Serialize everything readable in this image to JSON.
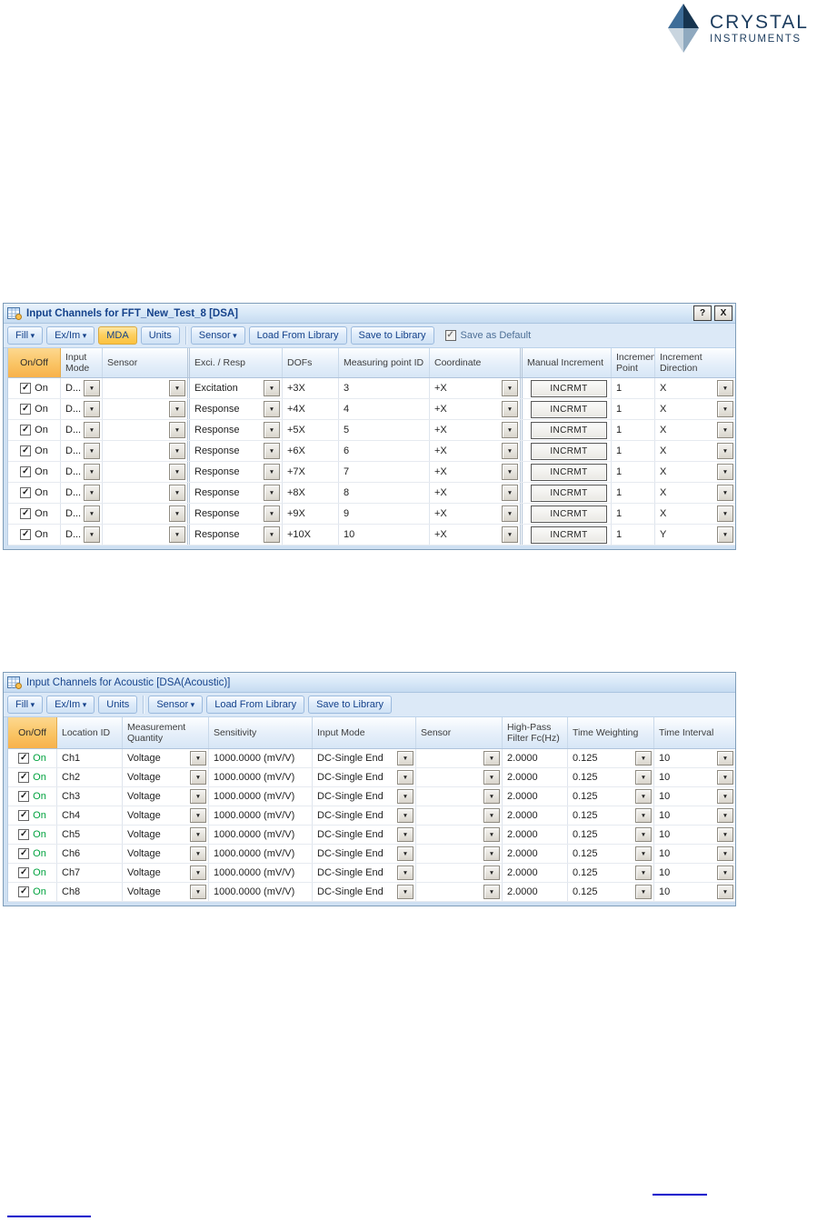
{
  "logo": {
    "line1": "CRYSTAL",
    "line2": "INSTRUMENTS"
  },
  "colors": {
    "accent_orange": "#FBBC50",
    "office_blue": "#15428B",
    "on_green": "#00A23E",
    "link_blue": "#0000CC",
    "logo_navy": "#1C3C5E"
  },
  "dialog1": {
    "title": "Input Channels for FFT_New_Test_8 [DSA]",
    "help_label": "?",
    "close_label": "X",
    "toolbar": {
      "fill": "Fill",
      "exim": "Ex/Im",
      "mda": "MDA",
      "units": "Units",
      "sensor": "Sensor",
      "load": "Load From Library",
      "save": "Save to Library",
      "save_default": "Save as Default",
      "save_default_checked": true
    },
    "columns": [
      "On/Off",
      "Input Mode",
      "Sensor",
      "Exci. / Resp",
      "DOFs",
      "Measuring point ID",
      "Coordinate",
      "Manual Increment",
      "Increment Point",
      "Increment Direction"
    ],
    "rows": [
      {
        "on": "On",
        "input_mode": "D...",
        "sensor": "",
        "exci_resp": "Excitation",
        "dofs": "+3X",
        "point_id": "3",
        "coordinate": "+X",
        "increment": "INCRMT",
        "inc_point": "1",
        "inc_dir": "X"
      },
      {
        "on": "On",
        "input_mode": "D...",
        "sensor": "",
        "exci_resp": "Response",
        "dofs": "+4X",
        "point_id": "4",
        "coordinate": "+X",
        "increment": "INCRMT",
        "inc_point": "1",
        "inc_dir": "X"
      },
      {
        "on": "On",
        "input_mode": "D...",
        "sensor": "",
        "exci_resp": "Response",
        "dofs": "+5X",
        "point_id": "5",
        "coordinate": "+X",
        "increment": "INCRMT",
        "inc_point": "1",
        "inc_dir": "X"
      },
      {
        "on": "On",
        "input_mode": "D...",
        "sensor": "",
        "exci_resp": "Response",
        "dofs": "+6X",
        "point_id": "6",
        "coordinate": "+X",
        "increment": "INCRMT",
        "inc_point": "1",
        "inc_dir": "X"
      },
      {
        "on": "On",
        "input_mode": "D...",
        "sensor": "",
        "exci_resp": "Response",
        "dofs": "+7X",
        "point_id": "7",
        "coordinate": "+X",
        "increment": "INCRMT",
        "inc_point": "1",
        "inc_dir": "X"
      },
      {
        "on": "On",
        "input_mode": "D...",
        "sensor": "",
        "exci_resp": "Response",
        "dofs": "+8X",
        "point_id": "8",
        "coordinate": "+X",
        "increment": "INCRMT",
        "inc_point": "1",
        "inc_dir": "X"
      },
      {
        "on": "On",
        "input_mode": "D...",
        "sensor": "",
        "exci_resp": "Response",
        "dofs": "+9X",
        "point_id": "9",
        "coordinate": "+X",
        "increment": "INCRMT",
        "inc_point": "1",
        "inc_dir": "X"
      },
      {
        "on": "On",
        "input_mode": "D...",
        "sensor": "",
        "exci_resp": "Response",
        "dofs": "+10X",
        "point_id": "10",
        "coordinate": "+X",
        "increment": "INCRMT",
        "inc_point": "1",
        "inc_dir": "Y"
      }
    ]
  },
  "dialog2": {
    "title": "Input Channels for Acoustic [DSA(Acoustic)]",
    "toolbar": {
      "fill": "Fill",
      "exim": "Ex/Im",
      "units": "Units",
      "sensor": "Sensor",
      "load": "Load From Library",
      "save": "Save to Library"
    },
    "columns": [
      "On/Off",
      "Location ID",
      "Measurement Quantity",
      "Sensitivity",
      "Input Mode",
      "Sensor",
      "High-Pass Filter Fc(Hz)",
      "Time Weighting",
      "Time Interval"
    ],
    "rows": [
      {
        "on": "On",
        "location": "Ch1",
        "quantity": "Voltage",
        "sensitivity": "1000.0000 (mV/V)",
        "input_mode": "DC-Single End",
        "sensor": "",
        "hp_filter": "2.0000",
        "time_weighting": "0.125",
        "time_interval": "10"
      },
      {
        "on": "On",
        "location": "Ch2",
        "quantity": "Voltage",
        "sensitivity": "1000.0000 (mV/V)",
        "input_mode": "DC-Single End",
        "sensor": "",
        "hp_filter": "2.0000",
        "time_weighting": "0.125",
        "time_interval": "10"
      },
      {
        "on": "On",
        "location": "Ch3",
        "quantity": "Voltage",
        "sensitivity": "1000.0000 (mV/V)",
        "input_mode": "DC-Single End",
        "sensor": "",
        "hp_filter": "2.0000",
        "time_weighting": "0.125",
        "time_interval": "10"
      },
      {
        "on": "On",
        "location": "Ch4",
        "quantity": "Voltage",
        "sensitivity": "1000.0000 (mV/V)",
        "input_mode": "DC-Single End",
        "sensor": "",
        "hp_filter": "2.0000",
        "time_weighting": "0.125",
        "time_interval": "10"
      },
      {
        "on": "On",
        "location": "Ch5",
        "quantity": "Voltage",
        "sensitivity": "1000.0000 (mV/V)",
        "input_mode": "DC-Single End",
        "sensor": "",
        "hp_filter": "2.0000",
        "time_weighting": "0.125",
        "time_interval": "10"
      },
      {
        "on": "On",
        "location": "Ch6",
        "quantity": "Voltage",
        "sensitivity": "1000.0000 (mV/V)",
        "input_mode": "DC-Single End",
        "sensor": "",
        "hp_filter": "2.0000",
        "time_weighting": "0.125",
        "time_interval": "10"
      },
      {
        "on": "On",
        "location": "Ch7",
        "quantity": "Voltage",
        "sensitivity": "1000.0000 (mV/V)",
        "input_mode": "DC-Single End",
        "sensor": "",
        "hp_filter": "2.0000",
        "time_weighting": "0.125",
        "time_interval": "10"
      },
      {
        "on": "On",
        "location": "Ch8",
        "quantity": "Voltage",
        "sensitivity": "1000.0000 (mV/V)",
        "input_mode": "DC-Single End",
        "sensor": "",
        "hp_filter": "2.0000",
        "time_weighting": "0.125",
        "time_interval": "10"
      }
    ]
  }
}
